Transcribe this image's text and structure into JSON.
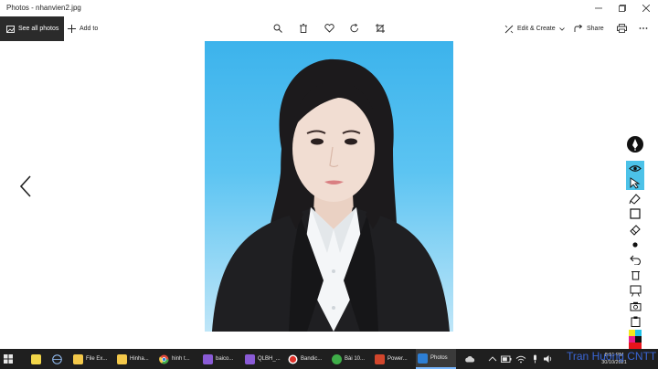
{
  "window": {
    "title": "Photos - nhanvien2.jpg"
  },
  "toolbar": {
    "see_all": "See all photos",
    "add_to": "Add to",
    "edit_create": "Edit & Create",
    "share": "Share"
  },
  "taskbar": {
    "items": [
      {
        "label": "File Ex...",
        "color": "#f3c84a"
      },
      {
        "label": "Hinha...",
        "color": "#f3c84a"
      },
      {
        "label": "hinh t...",
        "color": "#e04b3c"
      },
      {
        "label": "baico...",
        "color": "#8a5bd6"
      },
      {
        "label": "QLBH_...",
        "color": "#8a5bd6"
      },
      {
        "label": "Bandic...",
        "color": "#e0322a"
      },
      {
        "label": "Bài 10...",
        "color": "#3fae49"
      },
      {
        "label": "Power...",
        "color": "#d2462c"
      },
      {
        "label": "Photos",
        "color": "#2d7fd6"
      }
    ],
    "clock_time": "8:51 PM",
    "clock_date": "30/10/2021"
  },
  "watermark": "Tran Huong CNTT",
  "colors": {
    "toolbar_dark": "#2b2b2b",
    "taskbar": "#1f1f1f",
    "photo_bg": "#3cb3ec",
    "accent": "#2d7fd6"
  }
}
